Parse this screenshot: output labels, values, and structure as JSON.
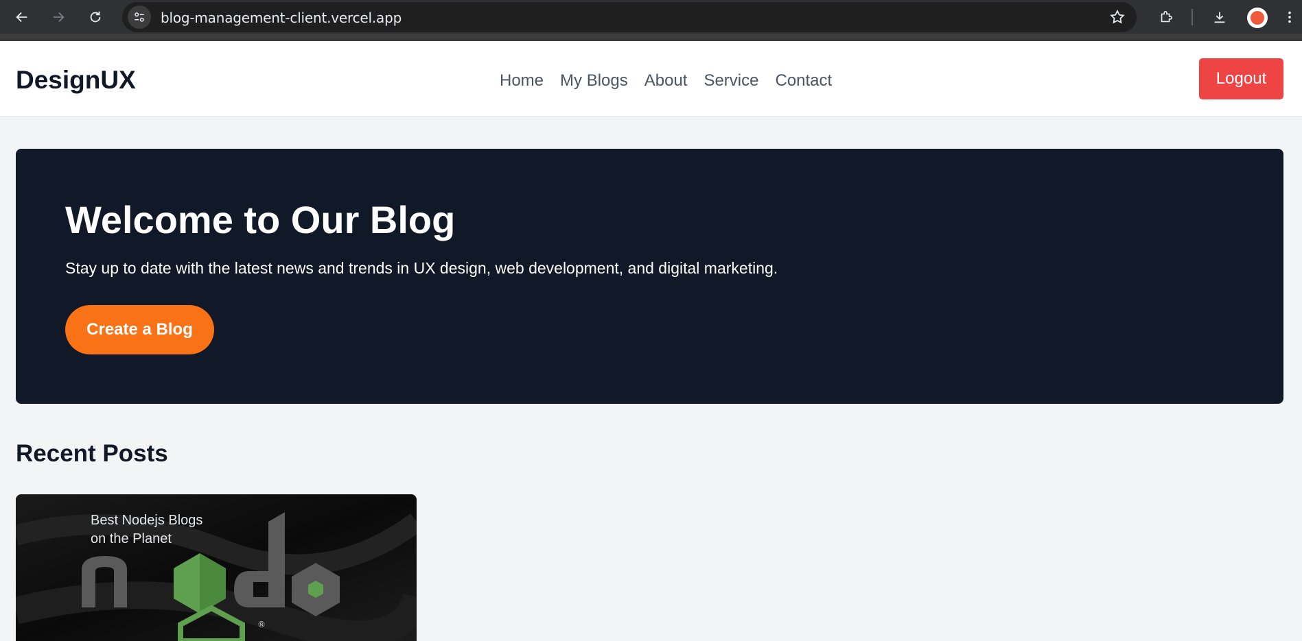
{
  "browser": {
    "url": "blog-management-client.vercel.app",
    "icons": [
      "back-icon",
      "forward-icon",
      "reload-icon",
      "site-info-icon",
      "star-icon",
      "extensions-icon",
      "download-icon",
      "profile-avatar",
      "more-icon"
    ]
  },
  "header": {
    "brand": "DesignUX",
    "nav": [
      "Home",
      "My Blogs",
      "About",
      "Service",
      "Contact"
    ],
    "logout_label": "Logout"
  },
  "hero": {
    "title": "Welcome to Our Blog",
    "subtitle": "Stay up to date with the latest news and trends in UX design, web development, and digital marketing.",
    "cta_label": "Create a Blog"
  },
  "recent": {
    "title": "Recent Posts",
    "posts": [
      {
        "image_caption_line1": "Best Nodejs Blogs",
        "image_caption_line2": "on the Planet"
      }
    ]
  },
  "colors": {
    "logout": "#ef4444",
    "hero_bg": "#111827",
    "cta": "#f97316",
    "page_bg": "#f3f4f6"
  }
}
